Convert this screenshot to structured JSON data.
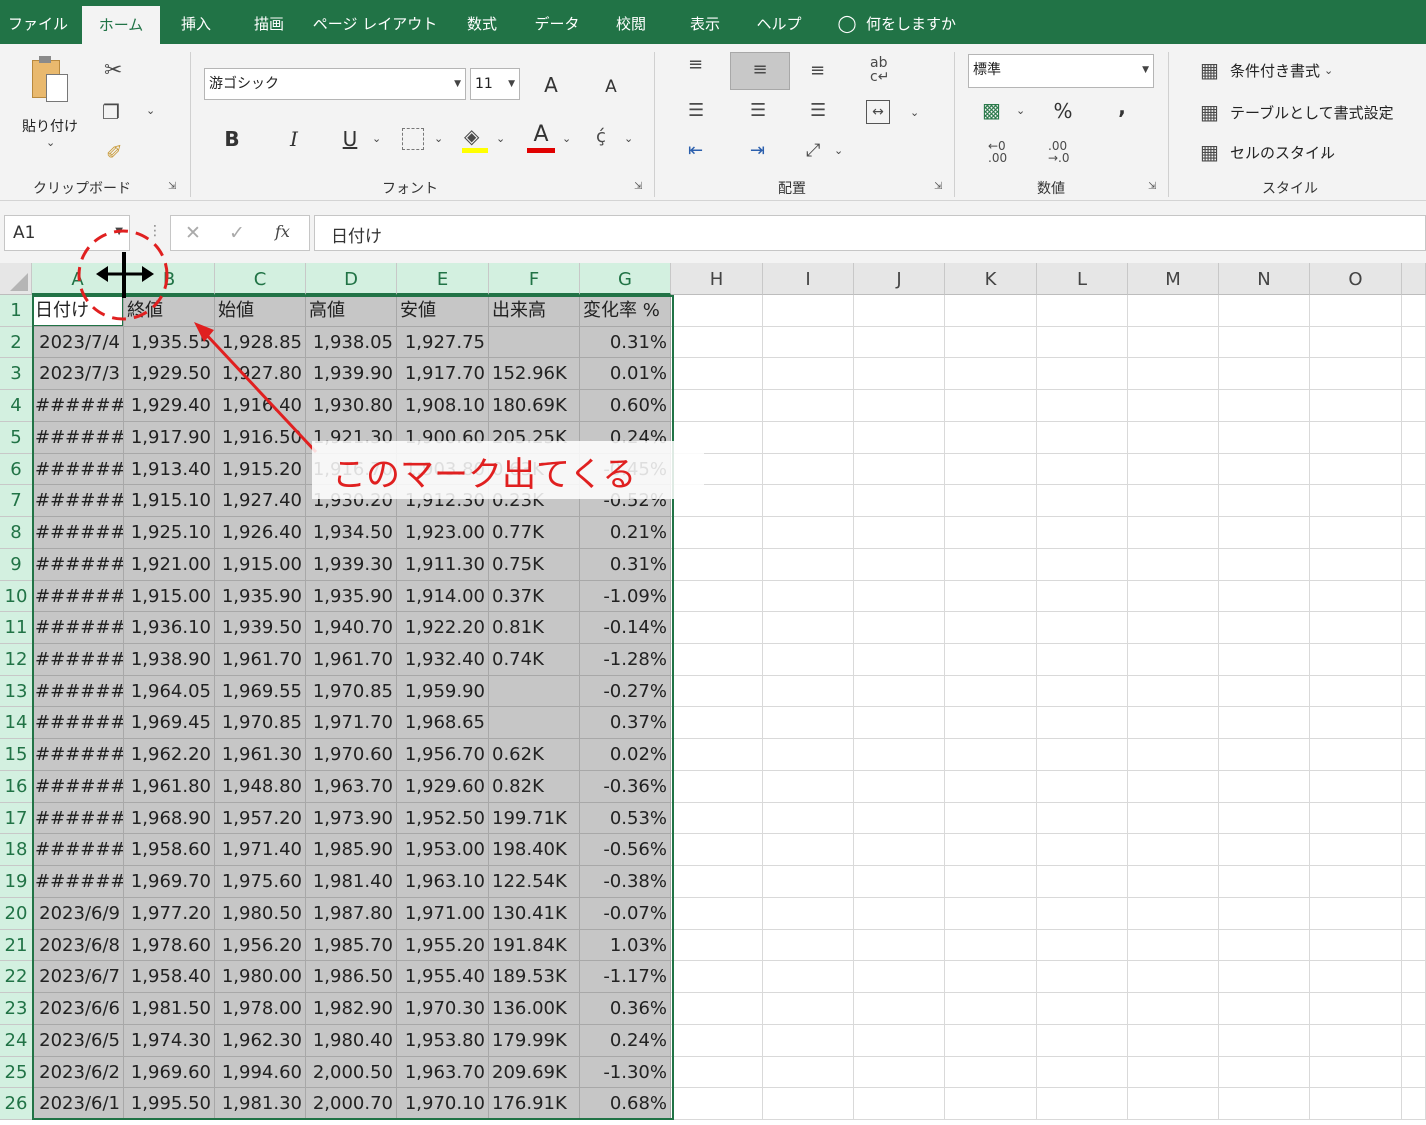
{
  "menu": {
    "tabs": [
      "ファイル",
      "ホーム",
      "挿入",
      "描画",
      "ページ レイアウト",
      "数式",
      "データ",
      "校閲",
      "表示",
      "ヘルプ"
    ],
    "active_tab": "ホーム",
    "tell_me": "何をしますか"
  },
  "ribbon": {
    "clipboard": {
      "paste_label": "貼り付け",
      "group_label": "クリップボード"
    },
    "font": {
      "font_name": "游ゴシック",
      "font_size": "11",
      "bold": "B",
      "italic": "I",
      "underline": "U",
      "font_color_glyph": "A",
      "increase_font": "A",
      "decrease_font": "A",
      "group_label": "フォント"
    },
    "alignment": {
      "group_label": "配置"
    },
    "number": {
      "format": "標準",
      "percent": "%",
      "comma": ",",
      "group_label": "数値"
    },
    "styles": {
      "conditional": "条件付き書式",
      "as_table": "テーブルとして書式設定",
      "cell_styles": "セルのスタイル",
      "group_label": "スタイル"
    }
  },
  "formula_bar": {
    "name_box": "A1",
    "fx": "fx",
    "content": "日付け"
  },
  "columns": [
    "A",
    "B",
    "C",
    "D",
    "E",
    "F",
    "G",
    "H",
    "I",
    "J",
    "K",
    "L",
    "M",
    "N",
    "O"
  ],
  "rows": [
    [
      "日付け",
      "終値",
      "始値",
      "高値",
      "安値",
      "出来高",
      "変化率 %"
    ],
    [
      "2023/7/4",
      "1,935.55",
      "1,928.85",
      "1,938.05",
      "1,927.75",
      "",
      "0.31%"
    ],
    [
      "2023/7/3",
      "1,929.50",
      "1,927.80",
      "1,939.90",
      "1,917.70",
      "152.96K",
      "0.01%"
    ],
    [
      "#######",
      "1,929.40",
      "1,916.40",
      "1,930.80",
      "1,908.10",
      "180.69K",
      "0.60%"
    ],
    [
      "#######",
      "1,917.90",
      "1,916.50",
      "1,921.30",
      "1,900.60",
      "205.25K",
      "0.24%"
    ],
    [
      "#######",
      "1,913.40",
      "1,915.20",
      "1,916.70",
      "1,903.80",
      "0.63K",
      "-0.45%"
    ],
    [
      "#######",
      "1,915.10",
      "1,927.40",
      "1,930.20",
      "1,912.30",
      "0.23K",
      "-0.52%"
    ],
    [
      "#######",
      "1,925.10",
      "1,926.40",
      "1,934.50",
      "1,923.00",
      "0.77K",
      "0.21%"
    ],
    [
      "#######",
      "1,921.00",
      "1,915.00",
      "1,939.30",
      "1,911.30",
      "0.75K",
      "0.31%"
    ],
    [
      "#######",
      "1,915.00",
      "1,935.90",
      "1,935.90",
      "1,914.00",
      "0.37K",
      "-1.09%"
    ],
    [
      "#######",
      "1,936.10",
      "1,939.50",
      "1,940.70",
      "1,922.20",
      "0.81K",
      "-0.14%"
    ],
    [
      "#######",
      "1,938.90",
      "1,961.70",
      "1,961.70",
      "1,932.40",
      "0.74K",
      "-1.28%"
    ],
    [
      "#######",
      "1,964.05",
      "1,969.55",
      "1,970.85",
      "1,959.90",
      "",
      "-0.27%"
    ],
    [
      "#######",
      "1,969.45",
      "1,970.85",
      "1,971.70",
      "1,968.65",
      "",
      "0.37%"
    ],
    [
      "#######",
      "1,962.20",
      "1,961.30",
      "1,970.60",
      "1,956.70",
      "0.62K",
      "0.02%"
    ],
    [
      "#######",
      "1,961.80",
      "1,948.80",
      "1,963.70",
      "1,929.60",
      "0.82K",
      "-0.36%"
    ],
    [
      "#######",
      "1,968.90",
      "1,957.20",
      "1,973.90",
      "1,952.50",
      "199.71K",
      "0.53%"
    ],
    [
      "#######",
      "1,958.60",
      "1,971.40",
      "1,985.90",
      "1,953.00",
      "198.40K",
      "-0.56%"
    ],
    [
      "#######",
      "1,969.70",
      "1,975.60",
      "1,981.40",
      "1,963.10",
      "122.54K",
      "-0.38%"
    ],
    [
      "2023/6/9",
      "1,977.20",
      "1,980.50",
      "1,987.80",
      "1,971.00",
      "130.41K",
      "-0.07%"
    ],
    [
      "2023/6/8",
      "1,978.60",
      "1,956.20",
      "1,985.70",
      "1,955.20",
      "191.84K",
      "1.03%"
    ],
    [
      "2023/6/7",
      "1,958.40",
      "1,980.00",
      "1,986.50",
      "1,955.40",
      "189.53K",
      "-1.17%"
    ],
    [
      "2023/6/6",
      "1,981.50",
      "1,978.00",
      "1,982.90",
      "1,970.30",
      "136.00K",
      "0.36%"
    ],
    [
      "2023/6/5",
      "1,974.30",
      "1,962.30",
      "1,980.40",
      "1,953.80",
      "179.99K",
      "0.24%"
    ],
    [
      "2023/6/2",
      "1,969.60",
      "1,994.60",
      "2,000.50",
      "1,963.70",
      "209.69K",
      "-1.30%"
    ],
    [
      "2023/6/1",
      "1,995.50",
      "1,981.30",
      "2,000.70",
      "1,970.10",
      "176.91K",
      "0.68%"
    ]
  ],
  "annotation": {
    "text": "このマーク出てくる",
    "color": "#e02020"
  },
  "colors": {
    "excel_green": "#217346",
    "selection_gray": "#c6c6c6"
  }
}
